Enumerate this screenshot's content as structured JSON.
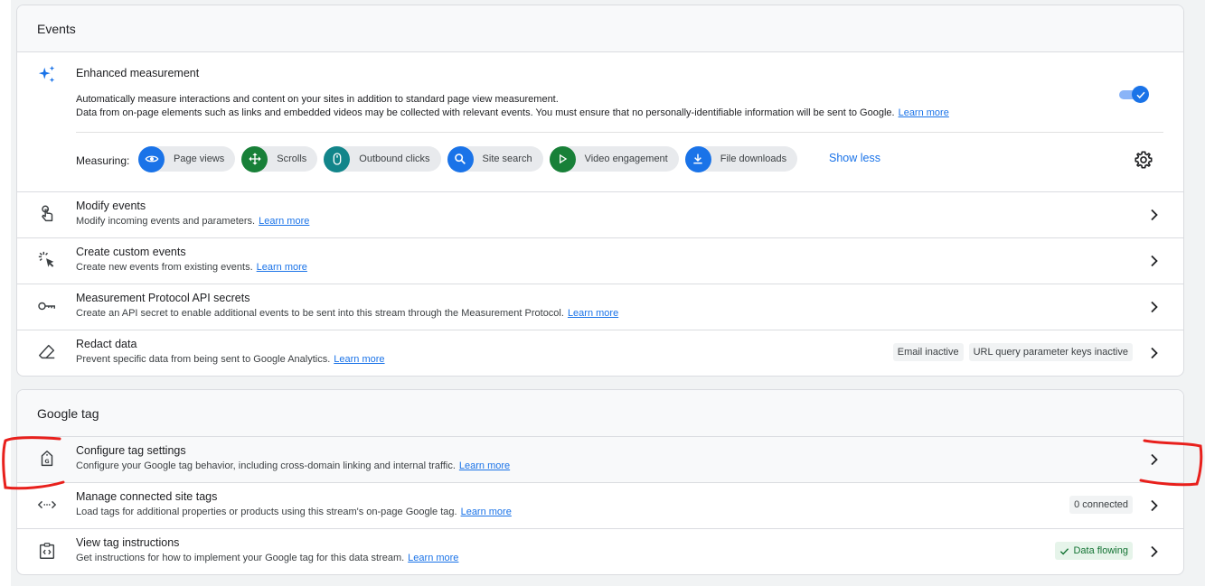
{
  "events": {
    "header": "Events",
    "enhanced": {
      "title": "Enhanced measurement",
      "line1": "Automatically measure interactions and content on your sites in addition to standard page view measurement.",
      "line2": "Data from on-page elements such as links and embedded videos may be collected with relevant events. You must ensure that no personally-identifiable information will be sent to Google.",
      "learn_more": "Learn more",
      "toggle_on": true,
      "measuring_label": "Measuring:",
      "chips": [
        {
          "label": "Page views",
          "icon": "eye-icon",
          "color": "#1a73e8"
        },
        {
          "label": "Scrolls",
          "icon": "scroll-arrows-icon",
          "color": "#188038"
        },
        {
          "label": "Outbound clicks",
          "icon": "mouse-icon",
          "color": "#12858a"
        },
        {
          "label": "Site search",
          "icon": "search-icon",
          "color": "#1a73e8"
        },
        {
          "label": "Video engagement",
          "icon": "play-icon",
          "color": "#188038"
        },
        {
          "label": "File downloads",
          "icon": "download-icon",
          "color": "#1a73e8"
        }
      ],
      "show_less": "Show less"
    },
    "rows": [
      {
        "title": "Modify events",
        "desc": "Modify incoming events and parameters.",
        "learn_more": "Learn more"
      },
      {
        "title": "Create custom events",
        "desc": "Create new events from existing events.",
        "learn_more": "Learn more"
      },
      {
        "title": "Measurement Protocol API secrets",
        "desc": "Create an API secret to enable additional events to be sent into this stream through the Measurement Protocol.",
        "learn_more": "Learn more"
      },
      {
        "title": "Redact data",
        "desc": "Prevent specific data from being sent to Google Analytics.",
        "learn_more": "Learn more",
        "tags": [
          "Email inactive",
          "URL query parameter keys inactive"
        ]
      }
    ]
  },
  "google_tag": {
    "header": "Google tag",
    "rows": [
      {
        "title": "Configure tag settings",
        "desc": "Configure your Google tag behavior, including cross-domain linking and internal traffic.",
        "learn_more": "Learn more"
      },
      {
        "title": "Manage connected site tags",
        "desc": "Load tags for additional properties or products using this stream's on-page Google tag.",
        "learn_more": "Learn more",
        "tag": "0 connected"
      },
      {
        "title": "View tag instructions",
        "desc": "Get instructions for how to implement your Google tag for this data stream.",
        "learn_more": "Learn more",
        "tag": "Data flowing"
      }
    ]
  },
  "colors": {
    "accent": "#1a73e8",
    "annotation": "#e8201c",
    "success": "#137333"
  }
}
